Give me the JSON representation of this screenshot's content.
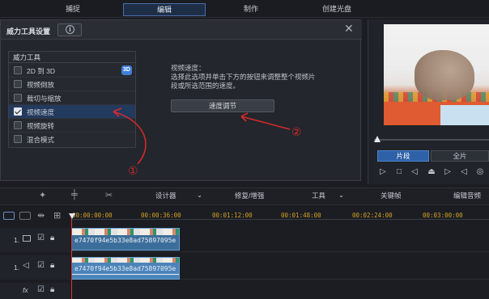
{
  "top_tabs": [
    "捕捉",
    "编辑",
    "制作",
    "创建光盘"
  ],
  "dialog": {
    "title": "威力工具设置",
    "info_icon": "i",
    "close_icon": "✕",
    "panel_heading": "威力工具",
    "tools": [
      {
        "label": "2D 到 3D",
        "checked": false,
        "badge": "3D"
      },
      {
        "label": "视频倒放",
        "checked": false
      },
      {
        "label": "裁切与缩放",
        "checked": false
      },
      {
        "label": "视频速度",
        "checked": true,
        "selected": true
      },
      {
        "label": "视频旋转",
        "checked": false
      },
      {
        "label": "混合模式",
        "checked": false
      }
    ],
    "description_title": "视频速度：",
    "description_body": "选择此选项并单击下方的按钮来调整整个视频片段或所选范围的速度。",
    "speed_button": "速度调节",
    "annotation_1": "①",
    "annotation_2": "②"
  },
  "preview": {
    "clip_tab": "片段",
    "full_tab": "全片"
  },
  "toolbar": {
    "designer": "设计器",
    "fix_enhance": "修复/增强",
    "tools": "工具",
    "keyframe": "关键帧",
    "edit_audio": "编辑音频"
  },
  "timeline": {
    "ruler": [
      "00:00:00:00",
      "00:00:36:00",
      "00:01:12:00",
      "00:01:48:00",
      "00:02:24:00",
      "00:03:00:00"
    ],
    "tracks": [
      {
        "label": "1.",
        "clip_name": "e7470f94e5b33e8ad75897095e"
      },
      {
        "label": "1.",
        "clip_name": "e7470f94e5b33e8ad75897095e"
      },
      {
        "label": "fx",
        "clip_name": ""
      }
    ]
  },
  "colors": {
    "accent": "#4a6fa8",
    "annotation_red": "#d22a2a",
    "ruler_text": "#d3a226",
    "playhead": "#e23434"
  }
}
